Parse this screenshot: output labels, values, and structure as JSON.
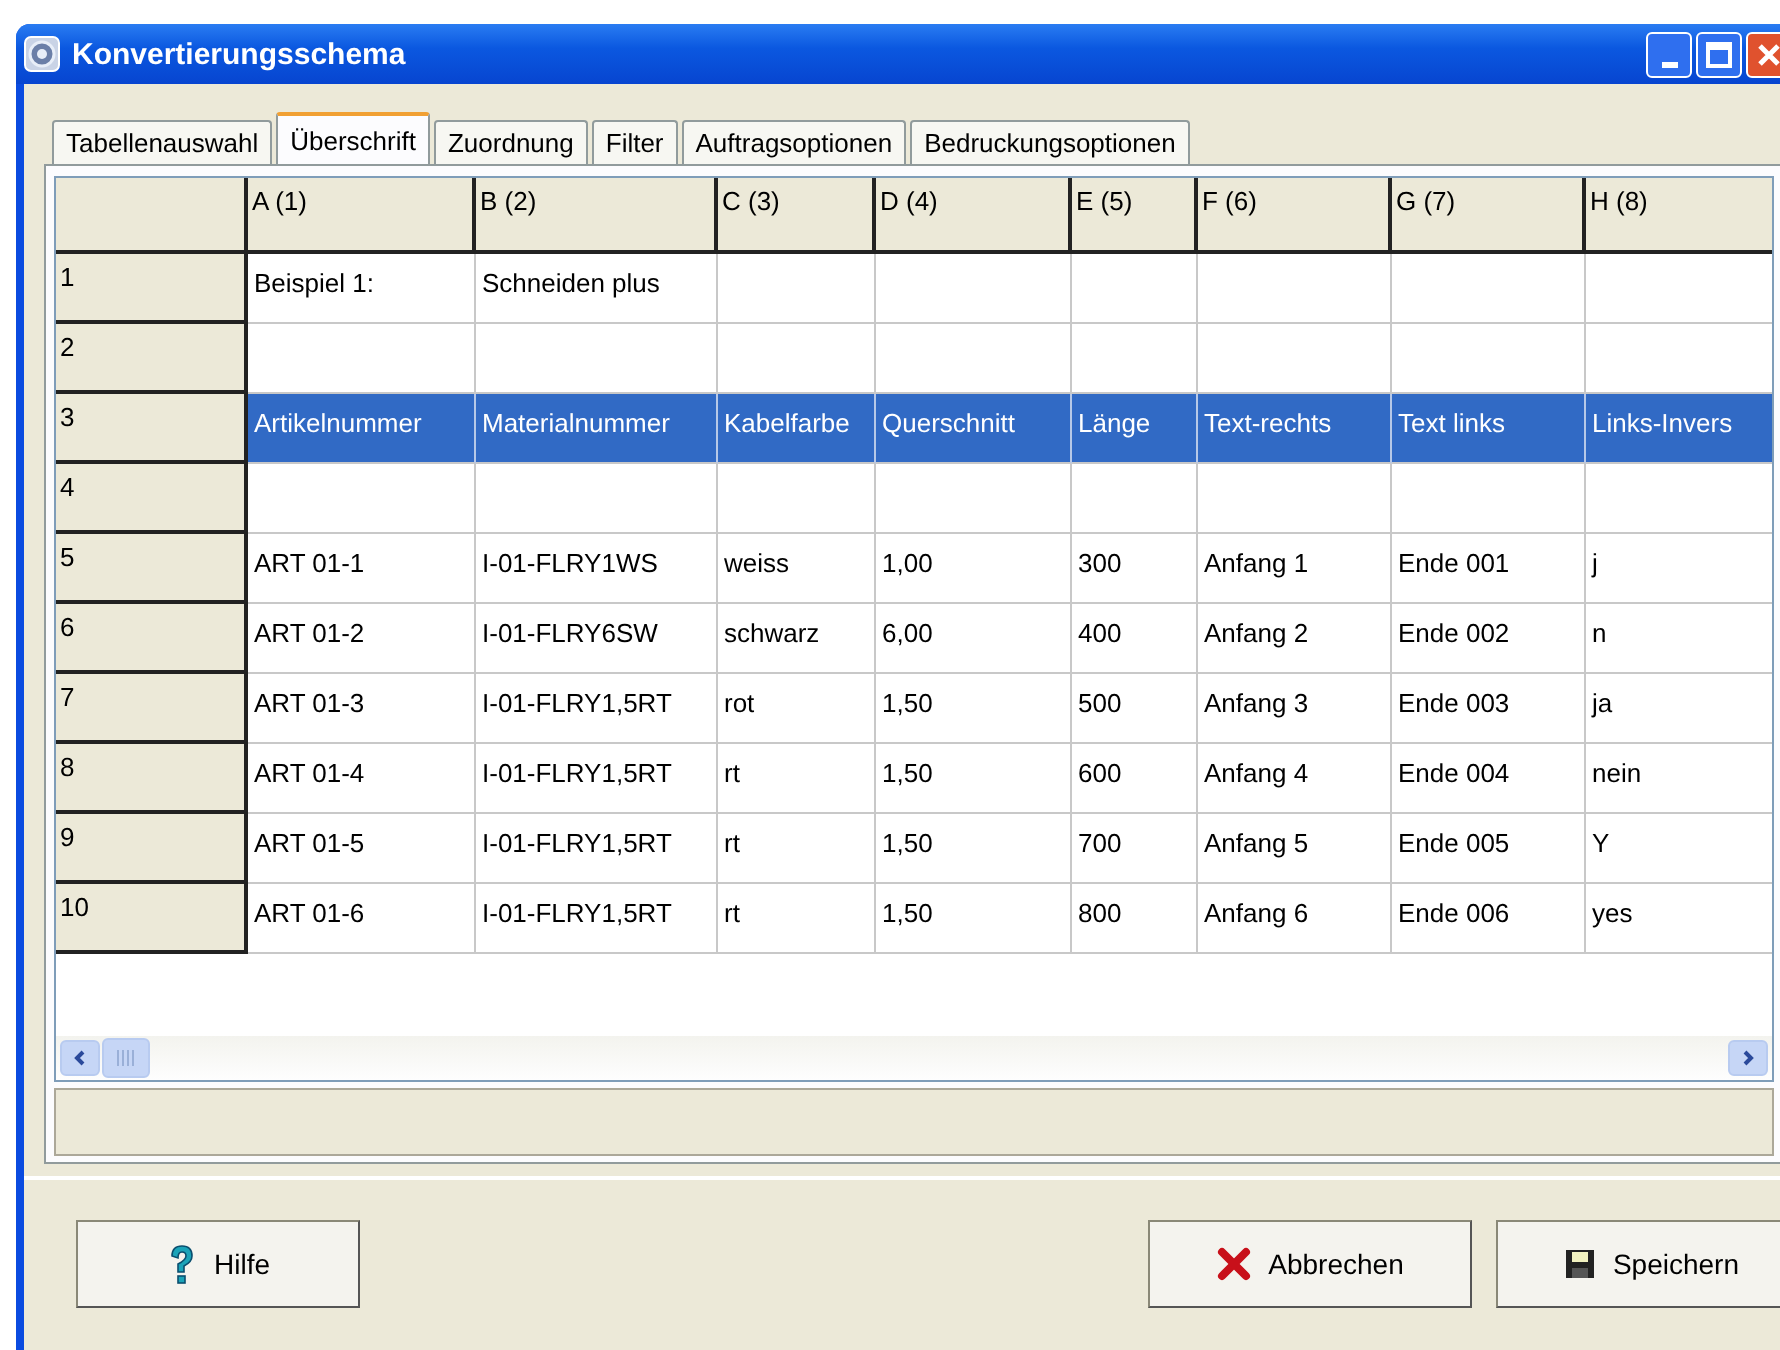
{
  "window": {
    "title": "Konvertierungsschema"
  },
  "tabs": [
    {
      "label": "Tabellenauswahl",
      "selected": false
    },
    {
      "label": "Überschrift",
      "selected": true
    },
    {
      "label": "Zuordnung",
      "selected": false
    },
    {
      "label": "Filter",
      "selected": false
    },
    {
      "label": "Auftragsoptionen",
      "selected": false
    },
    {
      "label": "Bedruckungsoptionen",
      "selected": false
    }
  ],
  "table": {
    "columns": [
      "A (1)",
      "B (2)",
      "C (3)",
      "D (4)",
      "E (5)",
      "F (6)",
      "G (7)",
      "H (8)"
    ],
    "rows": [
      {
        "header": "1",
        "selected": false,
        "cells": [
          "Beispiel 1:",
          "Schneiden plus"
        ]
      },
      {
        "header": "2",
        "selected": false,
        "cells": []
      },
      {
        "header": "3",
        "selected": true,
        "cells": [
          "Artikelnummer",
          "Materialnummer",
          "Kabelfarbe",
          "Querschnitt",
          "Länge",
          "Text-rechts",
          "Text links",
          "Links-Invers"
        ]
      },
      {
        "header": "4",
        "selected": false,
        "cells": []
      },
      {
        "header": "5",
        "selected": false,
        "cells": [
          "ART 01-1",
          "I-01-FLRY1WS",
          "weiss",
          "1,00",
          "300",
          "Anfang 1",
          "Ende 001",
          "j"
        ]
      },
      {
        "header": "6",
        "selected": false,
        "cells": [
          "ART 01-2",
          "I-01-FLRY6SW",
          "schwarz",
          "6,00",
          "400",
          "Anfang 2",
          "Ende 002",
          "n"
        ]
      },
      {
        "header": "7",
        "selected": false,
        "cells": [
          "ART 01-3",
          "I-01-FLRY1,5RT",
          "rot",
          "1,50",
          "500",
          "Anfang 3",
          "Ende 003",
          "ja"
        ]
      },
      {
        "header": "8",
        "selected": false,
        "cells": [
          "ART 01-4",
          "I-01-FLRY1,5RT",
          "rt",
          "1,50",
          "600",
          "Anfang 4",
          "Ende 004",
          "nein"
        ]
      },
      {
        "header": "9",
        "selected": false,
        "cells": [
          "ART 01-5",
          "I-01-FLRY1,5RT",
          "rt",
          "1,50",
          "700",
          "Anfang 5",
          "Ende 005",
          "Y"
        ]
      },
      {
        "header": "10",
        "selected": false,
        "cells": [
          "ART 01-6",
          "I-01-FLRY1,5RT",
          "rt",
          "1,50",
          "800",
          "Anfang 6",
          "Ende 006",
          "yes"
        ]
      }
    ]
  },
  "buttons": [
    {
      "kind": "help",
      "label": "Hilfe"
    },
    {
      "kind": "cancel",
      "label": "Abbrechen"
    },
    {
      "kind": "save",
      "label": "Speichern"
    }
  ]
}
